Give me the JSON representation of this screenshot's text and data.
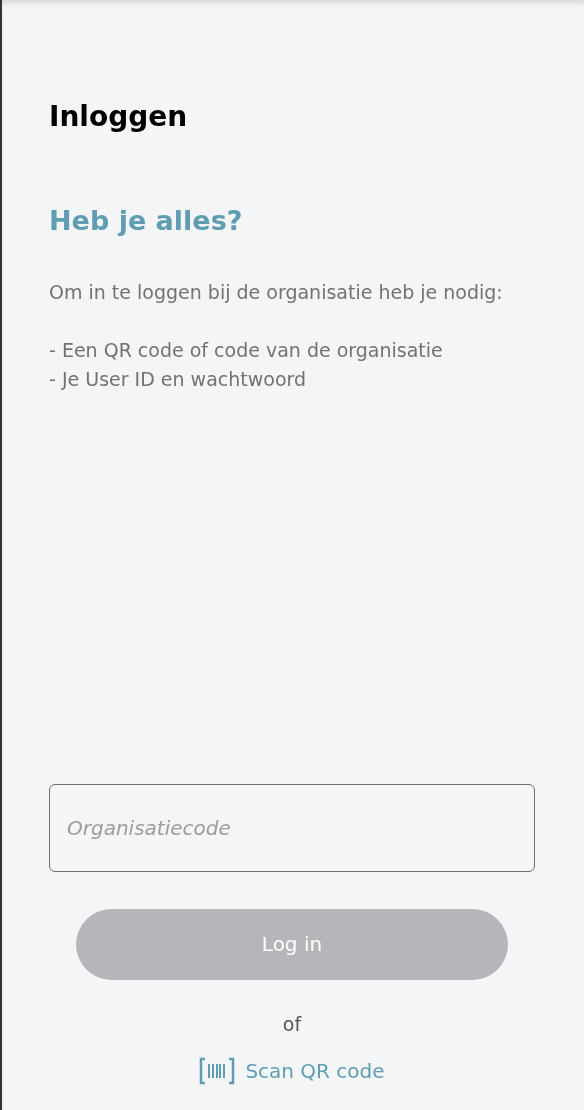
{
  "title": "Inloggen",
  "heading": "Heb je alles?",
  "intro": "Om in te loggen bij de organisatie heb je nodig:",
  "requirements": [
    "- Een QR code of code van de organisatie",
    "- Je User ID en wachtwoord"
  ],
  "code_field": {
    "placeholder": "Organisatiecode"
  },
  "login_button": {
    "label": "Log in",
    "disabled": true
  },
  "separator": "of",
  "scan_link": {
    "label": "Scan QR code"
  }
}
